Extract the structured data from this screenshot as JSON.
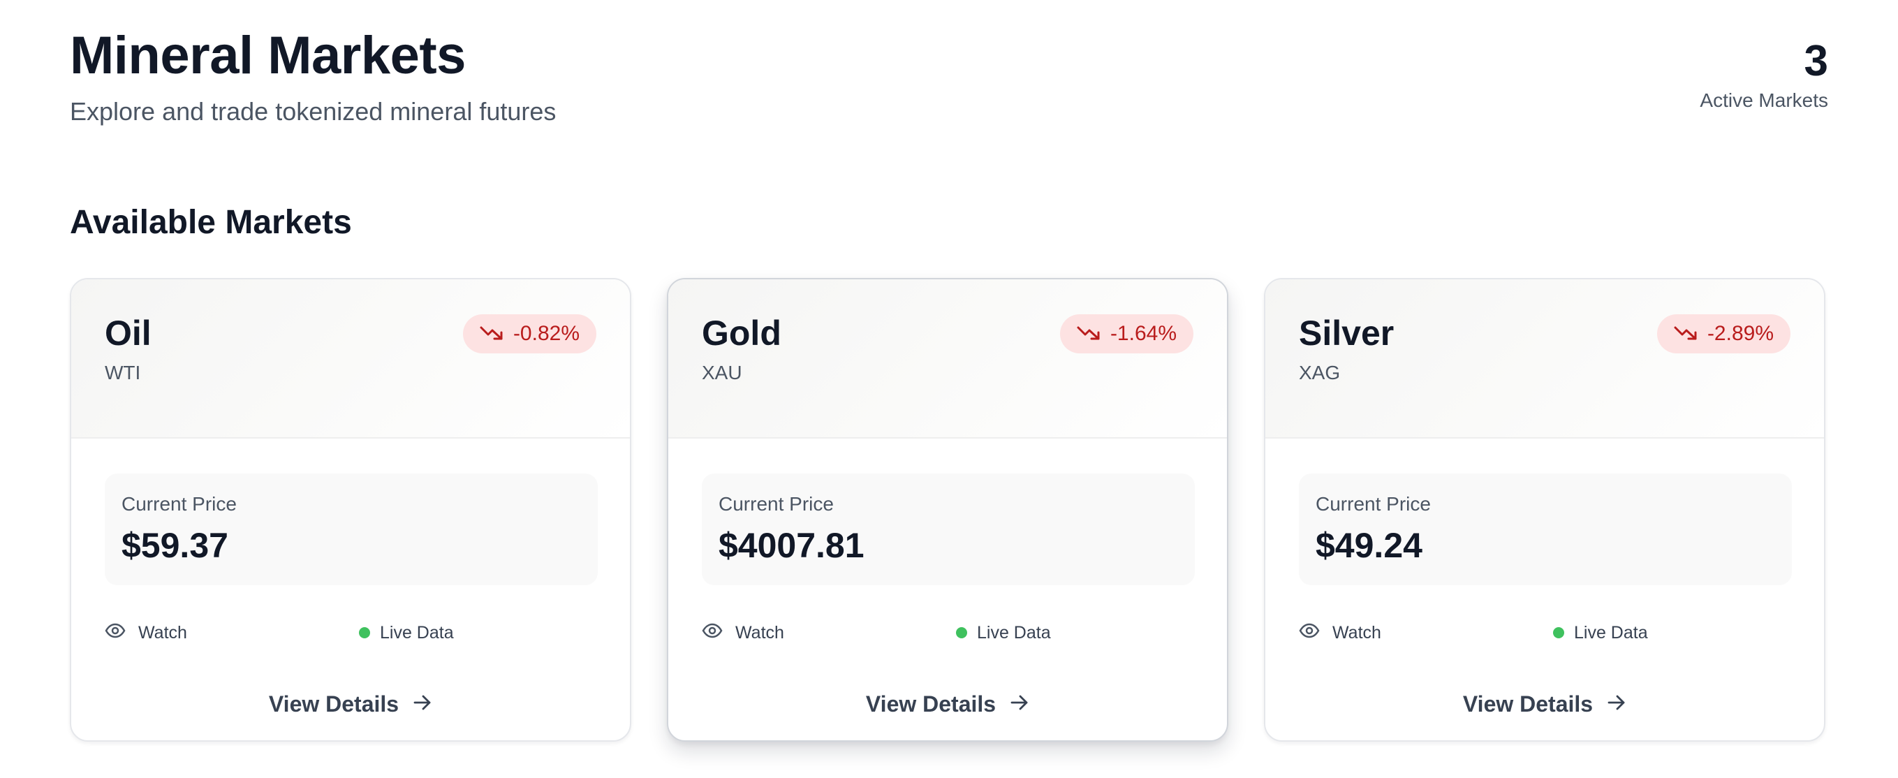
{
  "header": {
    "title": "Mineral Markets",
    "subtitle": "Explore and trade tokenized mineral futures",
    "active_markets_count": "3",
    "active_markets_label": "Active Markets"
  },
  "section_title": "Available Markets",
  "markets": [
    {
      "name": "Oil",
      "symbol": "WTI",
      "change": "-0.82%",
      "price_label": "Current Price",
      "price": "$59.37",
      "watch_label": "Watch",
      "live_label": "Live Data",
      "details_label": "View Details"
    },
    {
      "name": "Gold",
      "symbol": "XAU",
      "change": "-1.64%",
      "price_label": "Current Price",
      "price": "$4007.81",
      "watch_label": "Watch",
      "live_label": "Live Data",
      "details_label": "View Details"
    },
    {
      "name": "Silver",
      "symbol": "XAG",
      "change": "-2.89%",
      "price_label": "Current Price",
      "price": "$49.24",
      "watch_label": "Watch",
      "live_label": "Live Data",
      "details_label": "View Details"
    }
  ],
  "icons": {
    "change": "trending-down-icon",
    "watch": "eye-icon",
    "live": "live-dot-icon",
    "details": "arrow-right-icon"
  },
  "colors": {
    "negative": "#b91c1c",
    "negative_bg": "#fde2e2",
    "live": "#3fc15e",
    "text": "#111827",
    "muted": "#4b5563"
  }
}
